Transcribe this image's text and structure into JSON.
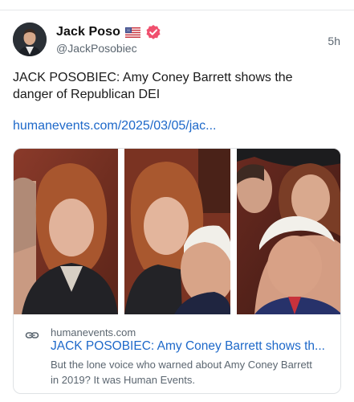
{
  "post": {
    "author_name": "Jack Poso",
    "author_handle": "@JackPosobiec",
    "timestamp": "5h",
    "flag_icon": "us-flag-icon",
    "verified_icon": "verified-badge-icon",
    "text": "JACK POSOBIEC: Amy Coney Barrett shows the danger of Republican DEI",
    "link_text": "humanevents.com/2025/03/05/jac..."
  },
  "link_card": {
    "domain": "humanevents.com",
    "title": "JACK POSOBIEC: Amy Coney Barrett shows th...",
    "description": "But the lone voice who warned about Amy Coney Barrett in 2019? It was Human Events."
  },
  "colors": {
    "link": "#1d68c9",
    "verified": "#f0506e",
    "muted": "#5b6670"
  }
}
